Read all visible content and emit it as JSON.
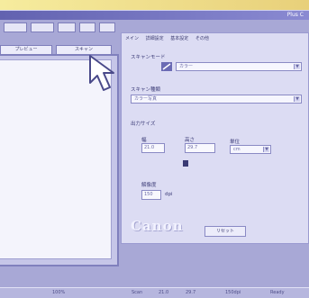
{
  "window": {
    "app_title": "Plus C",
    "accent_color": "#6464b4"
  },
  "toolbar": {
    "icons": [
      "zoom-in-icon",
      "zoom-out-icon",
      "fit-icon",
      "rotate-icon",
      "info-icon"
    ],
    "toggle_left_label": "プレビュー",
    "toggle_right_label": "スキャン"
  },
  "panel": {
    "tabs": [
      "メイン",
      "詳細設定",
      "基本設定",
      "その他"
    ],
    "scan_mode_label": "スキャンモード",
    "scan_mode_value": "カラー",
    "scan_type_label": "スキャン種類",
    "scan_type_value": "カラー写真",
    "size_label": "出力サイズ",
    "width_label": "幅",
    "width_value": "21.0",
    "height_label": "高さ",
    "height_value": "29.7",
    "unit_label": "単位",
    "unit_value": "cm",
    "resolution_label": "解像度",
    "resolution_value": "150",
    "resolution_unit": "dpi",
    "logo_text": "Canon",
    "reset_label": "リセット"
  },
  "statusbar": {
    "cells": [
      "100%",
      "Scan",
      "21.0",
      "29.7",
      "150dpi",
      "Ready"
    ]
  }
}
